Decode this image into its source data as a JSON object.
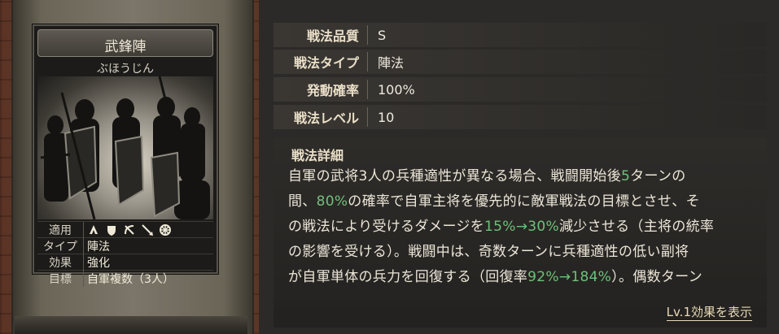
{
  "card": {
    "name": "武鋒陣",
    "reading": "ぶほうじん",
    "rows": [
      {
        "key": "適用",
        "icons": [
          "cavalry-icon",
          "shield-icon",
          "bow-icon",
          "spear-icon",
          "wheel-icon"
        ]
      },
      {
        "key": "タイプ",
        "value": "陣法"
      },
      {
        "key": "効果",
        "value": "強化"
      },
      {
        "key": "目標",
        "value": "自軍複数（3人）"
      }
    ]
  },
  "info": [
    {
      "label": "戦法品質",
      "value": "S"
    },
    {
      "label": "戦法タイプ",
      "value": "陣法"
    },
    {
      "label": "発動確率",
      "value": "100%"
    },
    {
      "label": "戦法レベル",
      "value": "10"
    }
  ],
  "detail": {
    "label": "戦法詳細",
    "segments": [
      {
        "t": "自軍の武将3人の兵種適性が異なる場合、戦闘開始後"
      },
      {
        "t": "5",
        "hl": true
      },
      {
        "t": "ターンの\n間、"
      },
      {
        "t": "80%",
        "hl": true
      },
      {
        "t": "の確率で自軍主将を優先的に敵軍戦法の目標とさせ、そ\nの戦法により受けるダメージを"
      },
      {
        "t": "15%→30%",
        "hl": true
      },
      {
        "t": "減少させる（主将の統率\nの影響を受ける）。戦闘中は、奇数ターンに兵種適性の低い副将\nが自軍単体の兵力を回復する（回復率"
      },
      {
        "t": "92%→184%",
        "hl": true
      },
      {
        "t": "）。偶数ターン\n"
      }
    ]
  },
  "lv_link": "Lv.1効果を表示",
  "colors": {
    "highlight": "#6fc07a",
    "accent": "#e6d9b6"
  }
}
